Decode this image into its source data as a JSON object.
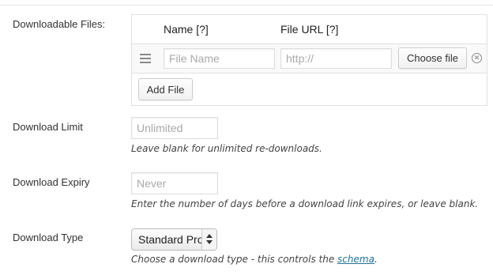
{
  "downloadable_files": {
    "label": "Downloadable Files:",
    "headers": {
      "name": "Name [?]",
      "url": "File URL [?]"
    },
    "rows": [
      {
        "name_placeholder": "File Name",
        "url_placeholder": "http://",
        "choose_label": "Choose file"
      }
    ],
    "add_label": "Add File"
  },
  "download_limit": {
    "label": "Download Limit",
    "placeholder": "Unlimited",
    "description": "Leave blank for unlimited re-downloads."
  },
  "download_expiry": {
    "label": "Download Expiry",
    "placeholder": "Never",
    "description": "Enter the number of days before a download link expires, or leave blank."
  },
  "download_type": {
    "label": "Download Type",
    "selected": "Standard Product",
    "description_prefix": "Choose a download type - this controls the ",
    "description_link": "schema",
    "description_suffix": "."
  },
  "colors": {
    "link": "#21759b",
    "border": "#e1e1e1",
    "row_bg": "#f9f9f9"
  }
}
